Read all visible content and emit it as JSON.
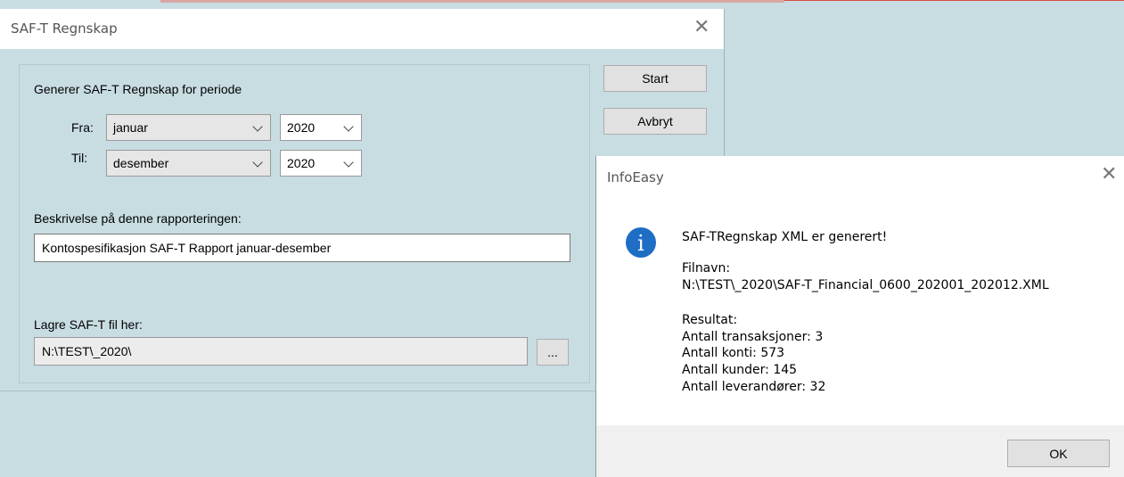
{
  "main_dialog": {
    "title": "SAF-T Regnskap",
    "period_heading": "Generer SAF-T Regnskap for periode",
    "from_label": "Fra:",
    "from_month": "januar",
    "from_year": "2020",
    "to_label": "Til:",
    "to_month": "desember",
    "to_year": "2020",
    "description_label": "Beskrivelse på denne rapporteringen:",
    "description_value": "Kontospesifikasjon SAF-T Rapport januar-desember",
    "save_label": "Lagre SAF-T fil her:",
    "save_path": "N:\\TEST\\_2020\\",
    "browse_label": "...",
    "start_label": "Start",
    "cancel_label": "Avbryt"
  },
  "message_box": {
    "title": "InfoEasy",
    "icon": "info-icon",
    "icon_glyph": "i",
    "headline": "SAF-TRegnskap XML er generert!",
    "filename_label": "Filnavn:",
    "filename_value": "N:\\TEST\\_2020\\SAF-T_Financial_0600_202001_202012.XML",
    "result_label": "Resultat:",
    "transactions": "Antall transaksjoner: 3",
    "accounts": "Antall konti: 573",
    "customers": "Antall kunder: 145",
    "suppliers": "Antall leverandører: 32",
    "ok_label": "OK"
  },
  "colors": {
    "dialog_bg": "#c8dde2",
    "info_blue": "#1f6ec5"
  }
}
